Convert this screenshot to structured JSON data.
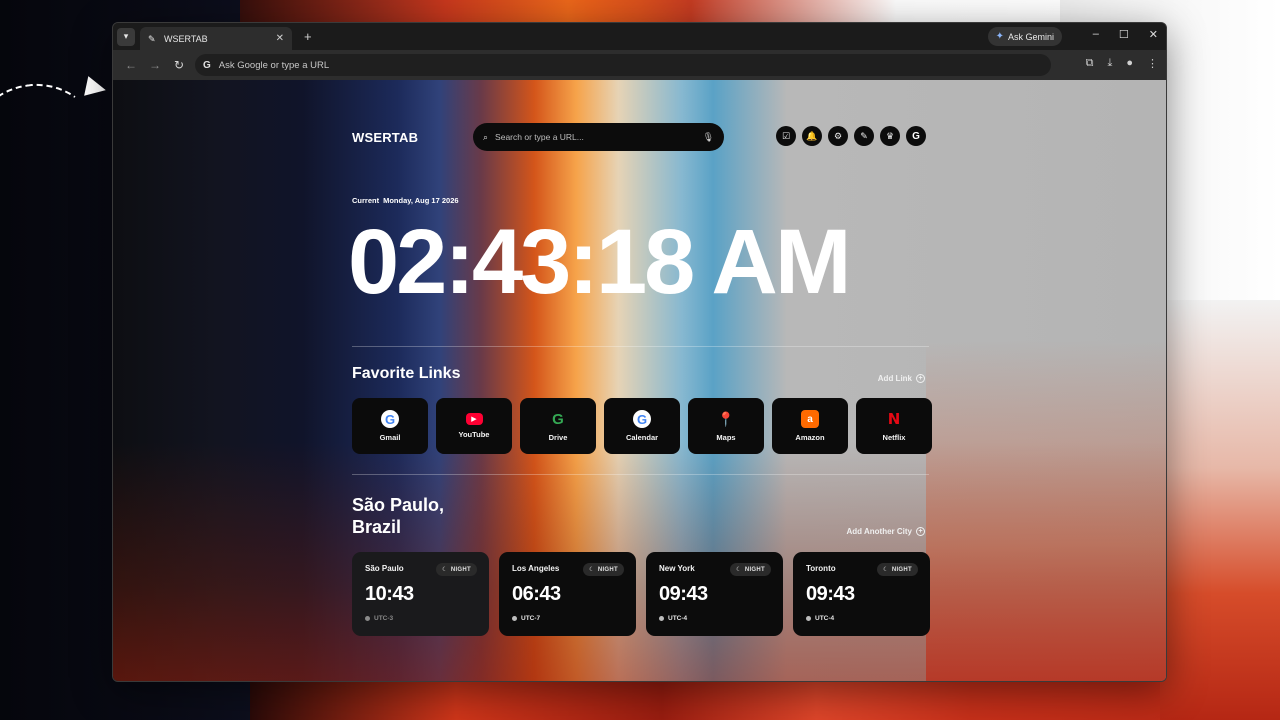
{
  "browser": {
    "tab_title": "WSERTAB",
    "tab_close": "✕",
    "new_tab": "+",
    "ask_gemini": "Ask Gemini",
    "omnibox_placeholder": "Ask Google or type a URL",
    "omnibox_g": "G"
  },
  "page": {
    "brand": "WSERTAB",
    "search_placeholder": "Search or type a URL...",
    "date_label": "Current",
    "date_value": "Monday, Aug 17 2026",
    "clock": "02:43:18 AM",
    "favorites": {
      "title": "Favorite Links",
      "add_label": "Add Link",
      "items": [
        {
          "label": "Gmail",
          "icon": "google-icon",
          "glyph": "G"
        },
        {
          "label": "YouTube",
          "icon": "youtube-icon",
          "glyph": "▶"
        },
        {
          "label": "Drive",
          "icon": "google-icon",
          "glyph": "G"
        },
        {
          "label": "Calendar",
          "icon": "google-icon",
          "glyph": "G"
        },
        {
          "label": "Maps",
          "icon": "maps-pin-icon",
          "glyph": "📍"
        },
        {
          "label": "Amazon",
          "icon": "amazon-icon",
          "glyph": "a"
        },
        {
          "label": "Netflix",
          "icon": "netflix-icon",
          "glyph": "N"
        }
      ]
    },
    "location": {
      "title_line1": "São Paulo,",
      "title_line2": "Brazil",
      "add_city_label": "Add Another City"
    },
    "cities": [
      {
        "name": "São Paulo",
        "badge": "NIGHT",
        "time": "10:43",
        "utc": "UTC-3"
      },
      {
        "name": "Los Angeles",
        "badge": "NIGHT",
        "time": "06:43",
        "utc": "UTC-7"
      },
      {
        "name": "New York",
        "badge": "NIGHT",
        "time": "09:43",
        "utc": "UTC-4"
      },
      {
        "name": "Toronto",
        "badge": "NIGHT",
        "time": "09:43",
        "utc": "UTC-4"
      }
    ]
  },
  "colors": {
    "card_bg": "#0c0c0c",
    "youtube_red": "#ff0033",
    "netflix_red": "#e50914",
    "amazon_orange": "#ff6a00"
  }
}
